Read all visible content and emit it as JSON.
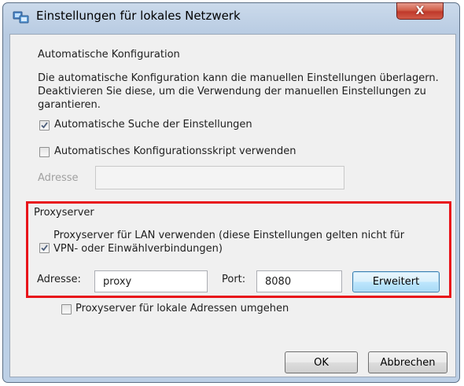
{
  "window": {
    "title": "Einstellungen für lokales Netzwerk",
    "close_label": "X",
    "title_icon": "network-settings-icon"
  },
  "auto_config": {
    "heading": "Automatische Konfiguration",
    "description_line1": "Die automatische Konfiguration kann die manuellen Einstellungen überlagern.",
    "description_line2": "Deaktivieren Sie diese, um die Verwendung der manuellen Einstellungen zu",
    "description_line3": "garantieren.",
    "auto_detect": {
      "label": "Automatische Suche der Einstellungen",
      "checked": true
    },
    "auto_script": {
      "label": "Automatisches Konfigurationsskript verwenden",
      "checked": false
    },
    "address_label": "Adresse",
    "address_value": ""
  },
  "proxy": {
    "heading": "Proxyserver",
    "use_proxy": {
      "label_line1": "Proxyserver für LAN verwenden (diese Einstellungen gelten nicht für",
      "label_line2": "VPN- oder Einwählverbindungen)",
      "checked": true
    },
    "address_label": "Adresse:",
    "address_value": "proxy",
    "port_label": "Port:",
    "port_value": "8080",
    "advanced_label": "Erweitert",
    "bypass_local": {
      "label": "Proxyserver für lokale Adressen umgehen",
      "checked": false
    }
  },
  "buttons": {
    "ok": "OK",
    "cancel": "Abbrechen"
  },
  "colors": {
    "highlight_border": "#e8131a",
    "title_bar": "#bdd0e6",
    "close_button": "#c0392b"
  }
}
